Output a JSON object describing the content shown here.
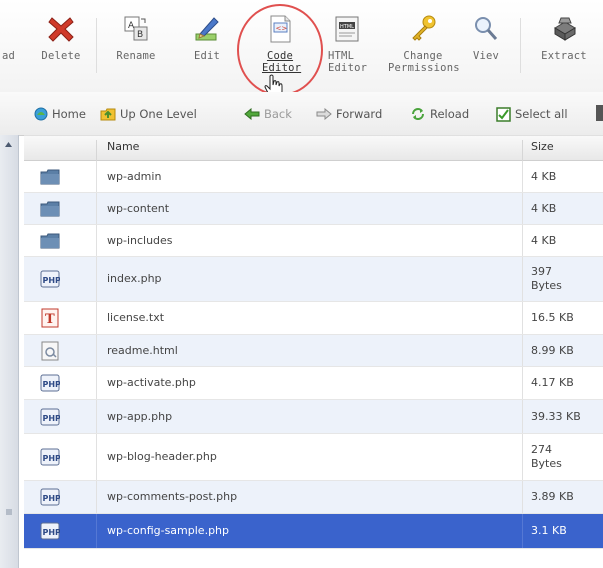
{
  "toolbar": {
    "buttons": [
      {
        "label": "ad"
      },
      {
        "label": "Delete"
      },
      {
        "label": "Rename"
      },
      {
        "label": "Edit"
      },
      {
        "label": "Code Editor"
      },
      {
        "label": "HTML Editor"
      },
      {
        "label": "Change Permissions"
      },
      {
        "label": "Viev"
      },
      {
        "label": "Extract"
      }
    ]
  },
  "nav": {
    "home": "Home",
    "up": "Up One Level",
    "back": "Back",
    "forward": "Forward",
    "reload": "Reload",
    "select_all": "Select all"
  },
  "table": {
    "headers": {
      "name": "Name",
      "size": "Size"
    },
    "rows": [
      {
        "name": "wp-admin",
        "size": "4 KB",
        "icon": "folder-icon"
      },
      {
        "name": "wp-content",
        "size": "4 KB",
        "icon": "folder-icon"
      },
      {
        "name": "wp-includes",
        "size": "4 KB",
        "icon": "folder-icon"
      },
      {
        "name": "index.php",
        "size": "397 Bytes",
        "icon": "php-file-icon"
      },
      {
        "name": "license.txt",
        "size": "16.5 KB",
        "icon": "text-file-icon"
      },
      {
        "name": "readme.html",
        "size": "8.99 KB",
        "icon": "html-file-icon"
      },
      {
        "name": "wp-activate.php",
        "size": "4.17 KB",
        "icon": "php-file-icon"
      },
      {
        "name": "wp-app.php",
        "size": "39.33 KB",
        "icon": "php-file-icon"
      },
      {
        "name": "wp-blog-header.php",
        "size": "274 Bytes",
        "icon": "php-file-icon"
      },
      {
        "name": "wp-comments-post.php",
        "size": "3.89 KB",
        "icon": "php-file-icon"
      },
      {
        "name": "wp-config-sample.php",
        "size": "3.1 KB",
        "icon": "php-file-icon"
      }
    ]
  },
  "colors": {
    "selection": "#3a63cc",
    "alt_row": "#edf2fa",
    "highlight_ring": "#e0504f"
  }
}
